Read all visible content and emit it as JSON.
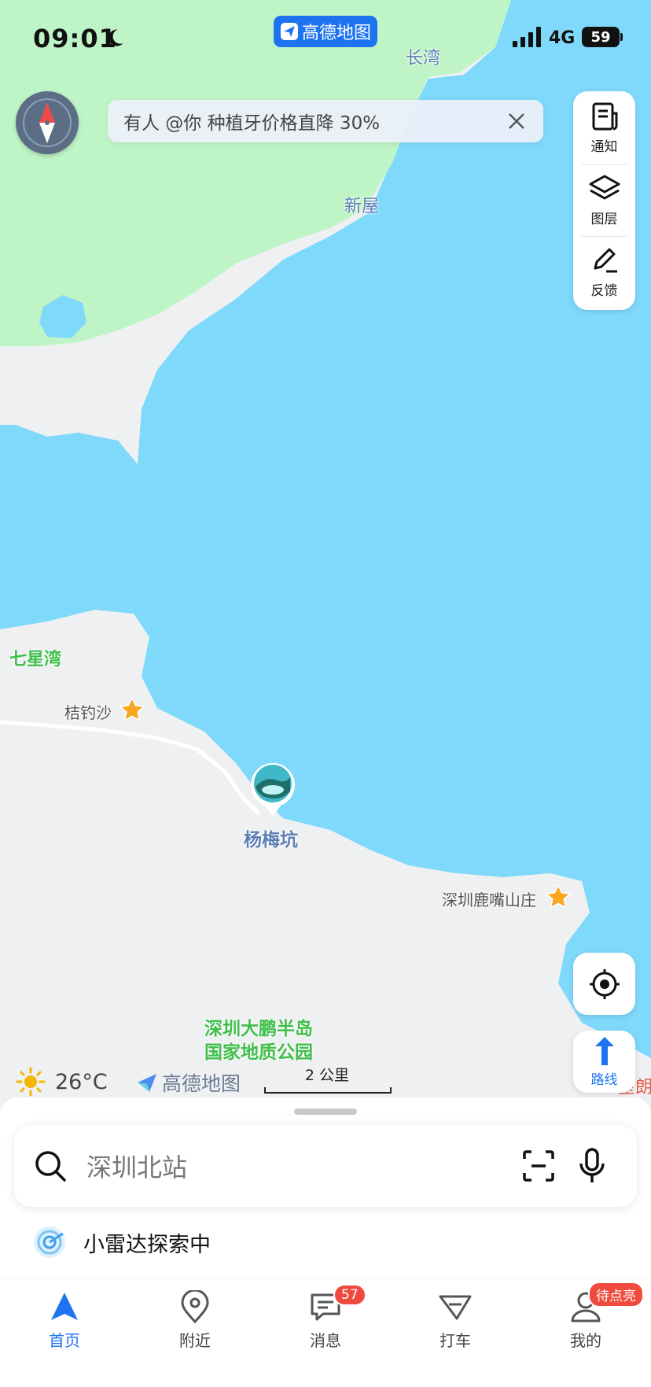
{
  "status_bar": {
    "time": "09:01",
    "network": "4G",
    "battery": "59",
    "app_pill": "高德地图"
  },
  "notice": {
    "text": "有人 @你 种植牙价格直降 30%"
  },
  "tools": {
    "notify": "通知",
    "layers": "图层",
    "feedback": "反馈"
  },
  "map_labels": {
    "changwan": "长湾",
    "xinwu": "新屋",
    "qixingwan": "七星湾",
    "judiaosha": "桔钓沙",
    "yangmeikeng": "杨梅坑",
    "lucuishanzhuang": "深圳鹿嘴山庄",
    "geopark_line1": "深圳大鹏半岛",
    "geopark_line2": "国家地质公园",
    "cut_label": "星朗"
  },
  "route_label": "路线",
  "weather": {
    "temp": "26°C"
  },
  "brand": "高德地图",
  "scale": "2 公里",
  "search": {
    "placeholder": "深圳北站"
  },
  "radar": {
    "text": "小雷达探索中"
  },
  "tabs": [
    {
      "label": "首页"
    },
    {
      "label": "附近"
    },
    {
      "label": "消息",
      "badge": "57"
    },
    {
      "label": "打车"
    },
    {
      "label": "我的",
      "badge": "待点亮"
    }
  ],
  "colors": {
    "water": "#7fd9fb",
    "land": "#eff0f2",
    "green": "#bff5c6",
    "accent": "#1e74f0"
  }
}
